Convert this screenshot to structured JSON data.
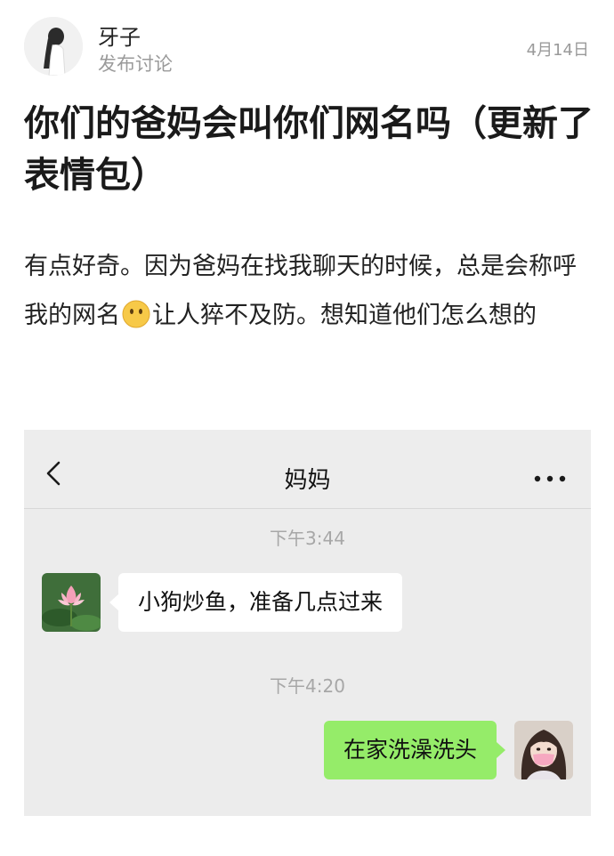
{
  "post": {
    "author": "牙子",
    "author_subtitle": "发布讨论",
    "date": "4月14日",
    "title": "你们的爸妈会叫你们网名吗（更新了表情包）",
    "body_part1": "有点好奇。因为爸妈在找我聊天的时候，总是会称呼我的网名",
    "body_emoji": "hushed-face-emoji",
    "body_part2": "让人猝不及防。想知道他们怎么想的"
  },
  "chat": {
    "title": "妈妈",
    "back_icon": "chevron-left-icon",
    "more_icon": "ellipsis-icon",
    "messages": [
      {
        "time": "下午3:44",
        "from": "contact",
        "text": "小狗炒鱼，准备几点过来",
        "avatar": "lotus-avatar"
      },
      {
        "time": "下午4:20",
        "from": "me",
        "text": "在家洗澡洗头",
        "avatar": "girl-avatar"
      }
    ]
  },
  "colors": {
    "chat_background": "#ececec",
    "outgoing_bubble": "#95ec69",
    "incoming_bubble": "#ffffff",
    "muted_text": "#9a9a9a"
  }
}
